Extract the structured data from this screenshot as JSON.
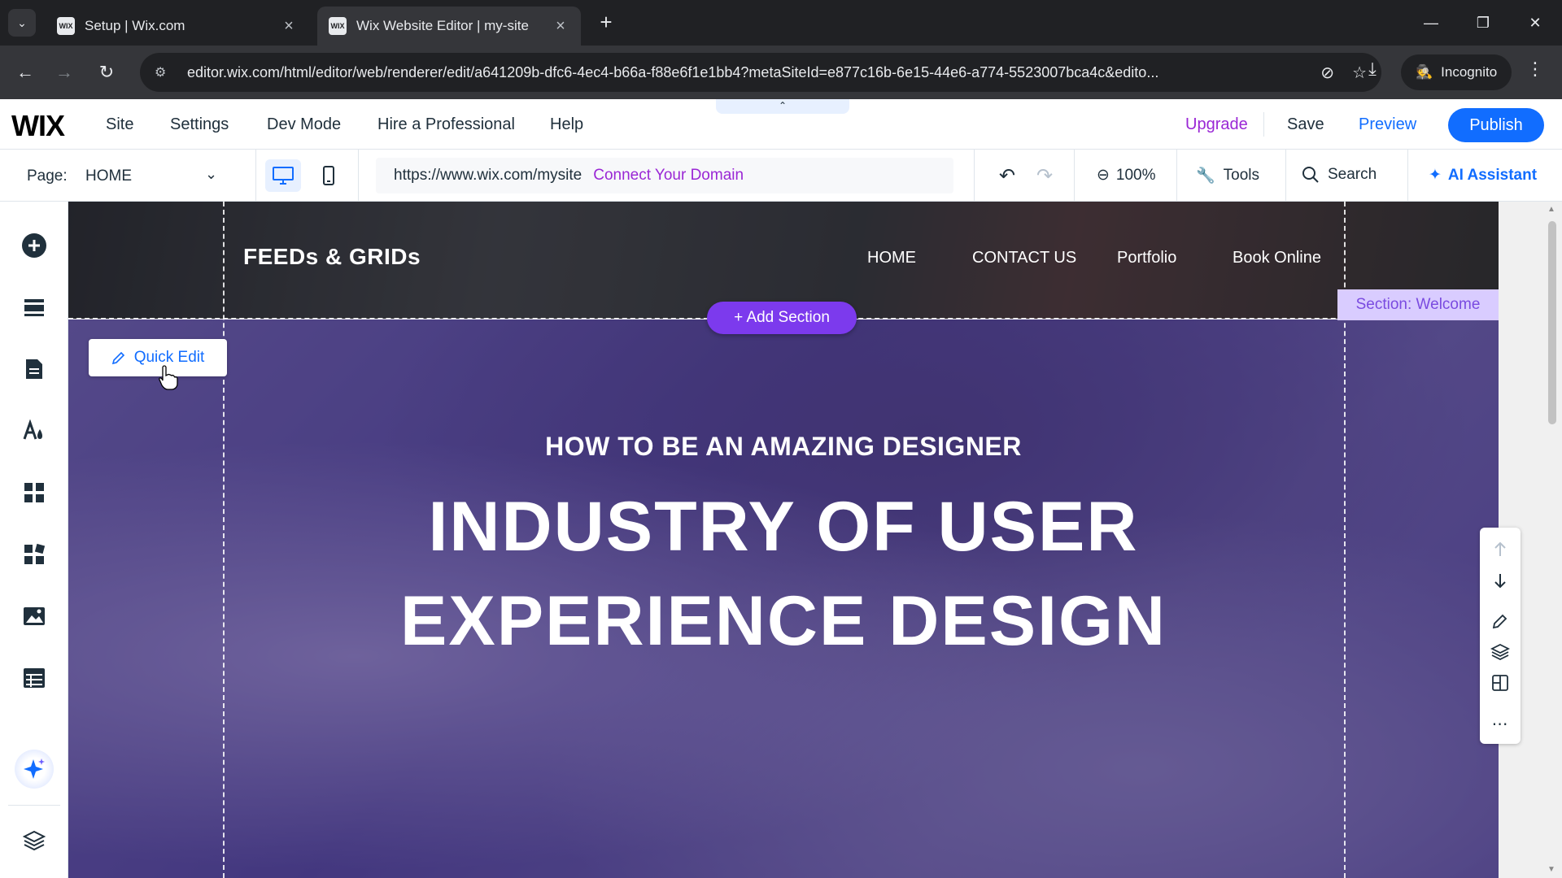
{
  "browser": {
    "tabs": [
      {
        "title": "Setup | Wix.com",
        "favicon": "WIX"
      },
      {
        "title": "Wix Website Editor | my-site",
        "favicon": "WIX"
      }
    ],
    "url": "editor.wix.com/html/editor/web/renderer/edit/a641209b-dfc6-4ec4-b66a-f88e6f1e1bb4?metaSiteId=e877c16b-6e15-44e6-a774-5523007bca4c&edito...",
    "incognito_label": "Incognito"
  },
  "wix": {
    "logo": "WIX",
    "menu": [
      "Site",
      "Settings",
      "Dev Mode",
      "Hire a Professional",
      "Help"
    ],
    "upgrade": "Upgrade",
    "save": "Save",
    "preview": "Preview",
    "publish": "Publish"
  },
  "toolbar2": {
    "page_label": "Page:",
    "page_value": "HOME",
    "site_url": "https://www.wix.com/mysite",
    "connect_domain": "Connect Your Domain",
    "zoom": "100%",
    "tools": "Tools",
    "search": "Search",
    "ai_assistant": "AI Assistant"
  },
  "site": {
    "brand": "FEEDs & GRIDs",
    "nav": [
      "HOME",
      "CONTACT US",
      "Portfolio",
      "Book Online"
    ],
    "section_tag": "Section: Welcome",
    "add_section": "Add Section",
    "quick_edit": "Quick Edit",
    "hero_subtitle": "HOW TO BE AN AMAZING DESIGNER",
    "hero_title_line1": "INDUSTRY OF USER",
    "hero_title_line2": "EXPERIENCE DESIGN"
  },
  "colors": {
    "accent_blue": "#116dff",
    "accent_purple": "#9a27d5",
    "add_section_purple": "#7c3aed"
  },
  "icons": {
    "left_toolbar": [
      "add-elements-icon",
      "sections-icon",
      "pages-icon",
      "site-design-icon",
      "apps-icon",
      "business-apps-icon",
      "media-icon",
      "cms-icon",
      "ai-sparkle-icon",
      "layers-icon"
    ],
    "right_rail": [
      "move-up-icon",
      "move-down-icon",
      "edit-pencil-icon",
      "layers-icon",
      "layout-icon",
      "more-icon"
    ]
  }
}
